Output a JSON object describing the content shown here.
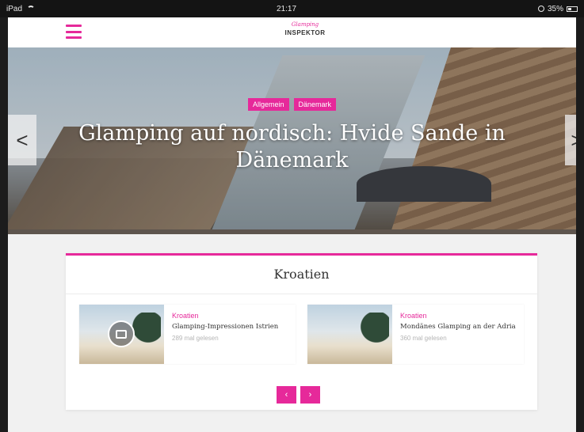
{
  "statusbar": {
    "device": "iPad",
    "time": "21:17",
    "battery": "35%"
  },
  "header": {
    "logo_script": "Glamping",
    "logo_main": "INSPEKTOR",
    "menu_icon": "hamburger-icon"
  },
  "hero": {
    "tags": [
      "Allgemein",
      "Dänemark"
    ],
    "title": "Glamping auf nordisch: Hvide Sande in Dänemark",
    "prev_label": "<",
    "next_label": ">"
  },
  "section": {
    "title": "Kroatien",
    "cards": [
      {
        "category": "Kroatien",
        "title": "Glamping-Impressionen Istrien",
        "meta": "289 mal gelesen"
      },
      {
        "category": "Kroatien",
        "title": "Mondänes Glamping an der Adria",
        "meta": "360 mal gelesen"
      }
    ],
    "pager": {
      "prev": "‹",
      "next": "›"
    }
  },
  "colors": {
    "accent": "#e6299a"
  }
}
